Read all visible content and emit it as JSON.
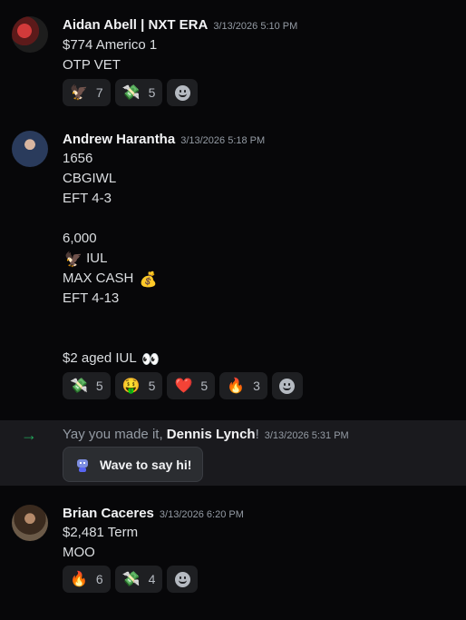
{
  "messages": [
    {
      "author": "Aidan Abell | NXT ERA",
      "timestamp": "3/13/2026 5:10 PM",
      "lines": [
        "$774 Americo 1",
        "OTP VET"
      ],
      "reactions": [
        {
          "emoji": "🦅",
          "count": "7"
        },
        {
          "emoji": "💸",
          "count": "5"
        }
      ]
    },
    {
      "author": "Andrew Harantha",
      "timestamp": "3/13/2026 5:18 PM",
      "lines": [
        "1656",
        "CBGIWL",
        "EFT 4-3",
        "6,000",
        "IUL",
        "MAX CASH",
        "EFT 4-13",
        "$2 aged IUL"
      ],
      "inline_emojis": [
        "🦅",
        "💰",
        "👀"
      ],
      "reactions": [
        {
          "emoji": "💸",
          "count": "5"
        },
        {
          "emoji": "🤑",
          "count": "5"
        },
        {
          "emoji": "❤️",
          "count": "5"
        },
        {
          "emoji": "🔥",
          "count": "3"
        }
      ]
    },
    {
      "author": "Brian Caceres",
      "timestamp": "3/13/2026 6:20 PM",
      "lines": [
        "$2,481 Term",
        "MOO"
      ],
      "reactions": [
        {
          "emoji": "🔥",
          "count": "6"
        },
        {
          "emoji": "💸",
          "count": "4"
        }
      ]
    }
  ],
  "system": {
    "prefix": "Yay you made it, ",
    "user": "Dennis Lynch",
    "suffix": "!",
    "timestamp": "3/13/2026 5:31 PM",
    "wave_label": "Wave to say hi!"
  },
  "icons": {
    "join_arrow": "arrow-right-icon",
    "add_reaction": "smiley-icon",
    "wave": "robot-icon"
  },
  "colors": {
    "background": "#070709",
    "accent_green": "#23a55a",
    "reaction_bg": "#1e1f22"
  }
}
